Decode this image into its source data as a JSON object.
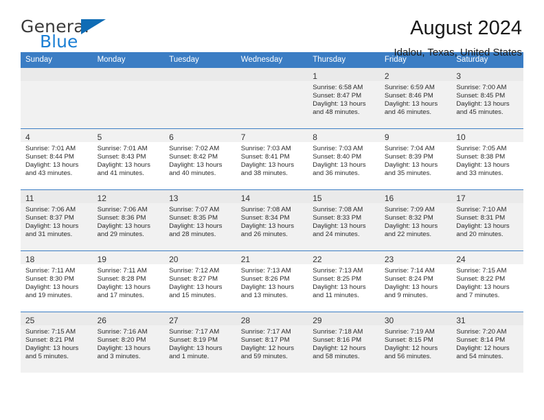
{
  "brand": {
    "name_part1": "General",
    "name_part2": "Blue",
    "triangle_color": "#0f6cb5",
    "blue_color": "#1b7fd4"
  },
  "header": {
    "title": "August 2024",
    "subtitle": "Idalou, Texas, United States"
  },
  "theme": {
    "header_bg": "#3b7dc4",
    "row_divider": "#3b7dc4",
    "daynum_bg": "#f1f1f1",
    "shaded_row_bg": "#f1f1f1"
  },
  "weekday_headers": [
    "Sunday",
    "Monday",
    "Tuesday",
    "Wednesday",
    "Thursday",
    "Friday",
    "Saturday"
  ],
  "weeks": [
    [
      {
        "day": "",
        "sunrise": "",
        "sunset": "",
        "daylight1": "",
        "daylight2": ""
      },
      {
        "day": "",
        "sunrise": "",
        "sunset": "",
        "daylight1": "",
        "daylight2": ""
      },
      {
        "day": "",
        "sunrise": "",
        "sunset": "",
        "daylight1": "",
        "daylight2": ""
      },
      {
        "day": "",
        "sunrise": "",
        "sunset": "",
        "daylight1": "",
        "daylight2": ""
      },
      {
        "day": "1",
        "sunrise": "Sunrise: 6:58 AM",
        "sunset": "Sunset: 8:47 PM",
        "daylight1": "Daylight: 13 hours",
        "daylight2": "and 48 minutes."
      },
      {
        "day": "2",
        "sunrise": "Sunrise: 6:59 AM",
        "sunset": "Sunset: 8:46 PM",
        "daylight1": "Daylight: 13 hours",
        "daylight2": "and 46 minutes."
      },
      {
        "day": "3",
        "sunrise": "Sunrise: 7:00 AM",
        "sunset": "Sunset: 8:45 PM",
        "daylight1": "Daylight: 13 hours",
        "daylight2": "and 45 minutes."
      }
    ],
    [
      {
        "day": "4",
        "sunrise": "Sunrise: 7:01 AM",
        "sunset": "Sunset: 8:44 PM",
        "daylight1": "Daylight: 13 hours",
        "daylight2": "and 43 minutes."
      },
      {
        "day": "5",
        "sunrise": "Sunrise: 7:01 AM",
        "sunset": "Sunset: 8:43 PM",
        "daylight1": "Daylight: 13 hours",
        "daylight2": "and 41 minutes."
      },
      {
        "day": "6",
        "sunrise": "Sunrise: 7:02 AM",
        "sunset": "Sunset: 8:42 PM",
        "daylight1": "Daylight: 13 hours",
        "daylight2": "and 40 minutes."
      },
      {
        "day": "7",
        "sunrise": "Sunrise: 7:03 AM",
        "sunset": "Sunset: 8:41 PM",
        "daylight1": "Daylight: 13 hours",
        "daylight2": "and 38 minutes."
      },
      {
        "day": "8",
        "sunrise": "Sunrise: 7:03 AM",
        "sunset": "Sunset: 8:40 PM",
        "daylight1": "Daylight: 13 hours",
        "daylight2": "and 36 minutes."
      },
      {
        "day": "9",
        "sunrise": "Sunrise: 7:04 AM",
        "sunset": "Sunset: 8:39 PM",
        "daylight1": "Daylight: 13 hours",
        "daylight2": "and 35 minutes."
      },
      {
        "day": "10",
        "sunrise": "Sunrise: 7:05 AM",
        "sunset": "Sunset: 8:38 PM",
        "daylight1": "Daylight: 13 hours",
        "daylight2": "and 33 minutes."
      }
    ],
    [
      {
        "day": "11",
        "sunrise": "Sunrise: 7:06 AM",
        "sunset": "Sunset: 8:37 PM",
        "daylight1": "Daylight: 13 hours",
        "daylight2": "and 31 minutes."
      },
      {
        "day": "12",
        "sunrise": "Sunrise: 7:06 AM",
        "sunset": "Sunset: 8:36 PM",
        "daylight1": "Daylight: 13 hours",
        "daylight2": "and 29 minutes."
      },
      {
        "day": "13",
        "sunrise": "Sunrise: 7:07 AM",
        "sunset": "Sunset: 8:35 PM",
        "daylight1": "Daylight: 13 hours",
        "daylight2": "and 28 minutes."
      },
      {
        "day": "14",
        "sunrise": "Sunrise: 7:08 AM",
        "sunset": "Sunset: 8:34 PM",
        "daylight1": "Daylight: 13 hours",
        "daylight2": "and 26 minutes."
      },
      {
        "day": "15",
        "sunrise": "Sunrise: 7:08 AM",
        "sunset": "Sunset: 8:33 PM",
        "daylight1": "Daylight: 13 hours",
        "daylight2": "and 24 minutes."
      },
      {
        "day": "16",
        "sunrise": "Sunrise: 7:09 AM",
        "sunset": "Sunset: 8:32 PM",
        "daylight1": "Daylight: 13 hours",
        "daylight2": "and 22 minutes."
      },
      {
        "day": "17",
        "sunrise": "Sunrise: 7:10 AM",
        "sunset": "Sunset: 8:31 PM",
        "daylight1": "Daylight: 13 hours",
        "daylight2": "and 20 minutes."
      }
    ],
    [
      {
        "day": "18",
        "sunrise": "Sunrise: 7:11 AM",
        "sunset": "Sunset: 8:30 PM",
        "daylight1": "Daylight: 13 hours",
        "daylight2": "and 19 minutes."
      },
      {
        "day": "19",
        "sunrise": "Sunrise: 7:11 AM",
        "sunset": "Sunset: 8:28 PM",
        "daylight1": "Daylight: 13 hours",
        "daylight2": "and 17 minutes."
      },
      {
        "day": "20",
        "sunrise": "Sunrise: 7:12 AM",
        "sunset": "Sunset: 8:27 PM",
        "daylight1": "Daylight: 13 hours",
        "daylight2": "and 15 minutes."
      },
      {
        "day": "21",
        "sunrise": "Sunrise: 7:13 AM",
        "sunset": "Sunset: 8:26 PM",
        "daylight1": "Daylight: 13 hours",
        "daylight2": "and 13 minutes."
      },
      {
        "day": "22",
        "sunrise": "Sunrise: 7:13 AM",
        "sunset": "Sunset: 8:25 PM",
        "daylight1": "Daylight: 13 hours",
        "daylight2": "and 11 minutes."
      },
      {
        "day": "23",
        "sunrise": "Sunrise: 7:14 AM",
        "sunset": "Sunset: 8:24 PM",
        "daylight1": "Daylight: 13 hours",
        "daylight2": "and 9 minutes."
      },
      {
        "day": "24",
        "sunrise": "Sunrise: 7:15 AM",
        "sunset": "Sunset: 8:22 PM",
        "daylight1": "Daylight: 13 hours",
        "daylight2": "and 7 minutes."
      }
    ],
    [
      {
        "day": "25",
        "sunrise": "Sunrise: 7:15 AM",
        "sunset": "Sunset: 8:21 PM",
        "daylight1": "Daylight: 13 hours",
        "daylight2": "and 5 minutes."
      },
      {
        "day": "26",
        "sunrise": "Sunrise: 7:16 AM",
        "sunset": "Sunset: 8:20 PM",
        "daylight1": "Daylight: 13 hours",
        "daylight2": "and 3 minutes."
      },
      {
        "day": "27",
        "sunrise": "Sunrise: 7:17 AM",
        "sunset": "Sunset: 8:19 PM",
        "daylight1": "Daylight: 13 hours",
        "daylight2": "and 1 minute."
      },
      {
        "day": "28",
        "sunrise": "Sunrise: 7:17 AM",
        "sunset": "Sunset: 8:17 PM",
        "daylight1": "Daylight: 12 hours",
        "daylight2": "and 59 minutes."
      },
      {
        "day": "29",
        "sunrise": "Sunrise: 7:18 AM",
        "sunset": "Sunset: 8:16 PM",
        "daylight1": "Daylight: 12 hours",
        "daylight2": "and 58 minutes."
      },
      {
        "day": "30",
        "sunrise": "Sunrise: 7:19 AM",
        "sunset": "Sunset: 8:15 PM",
        "daylight1": "Daylight: 12 hours",
        "daylight2": "and 56 minutes."
      },
      {
        "day": "31",
        "sunrise": "Sunrise: 7:20 AM",
        "sunset": "Sunset: 8:14 PM",
        "daylight1": "Daylight: 12 hours",
        "daylight2": "and 54 minutes."
      }
    ]
  ]
}
